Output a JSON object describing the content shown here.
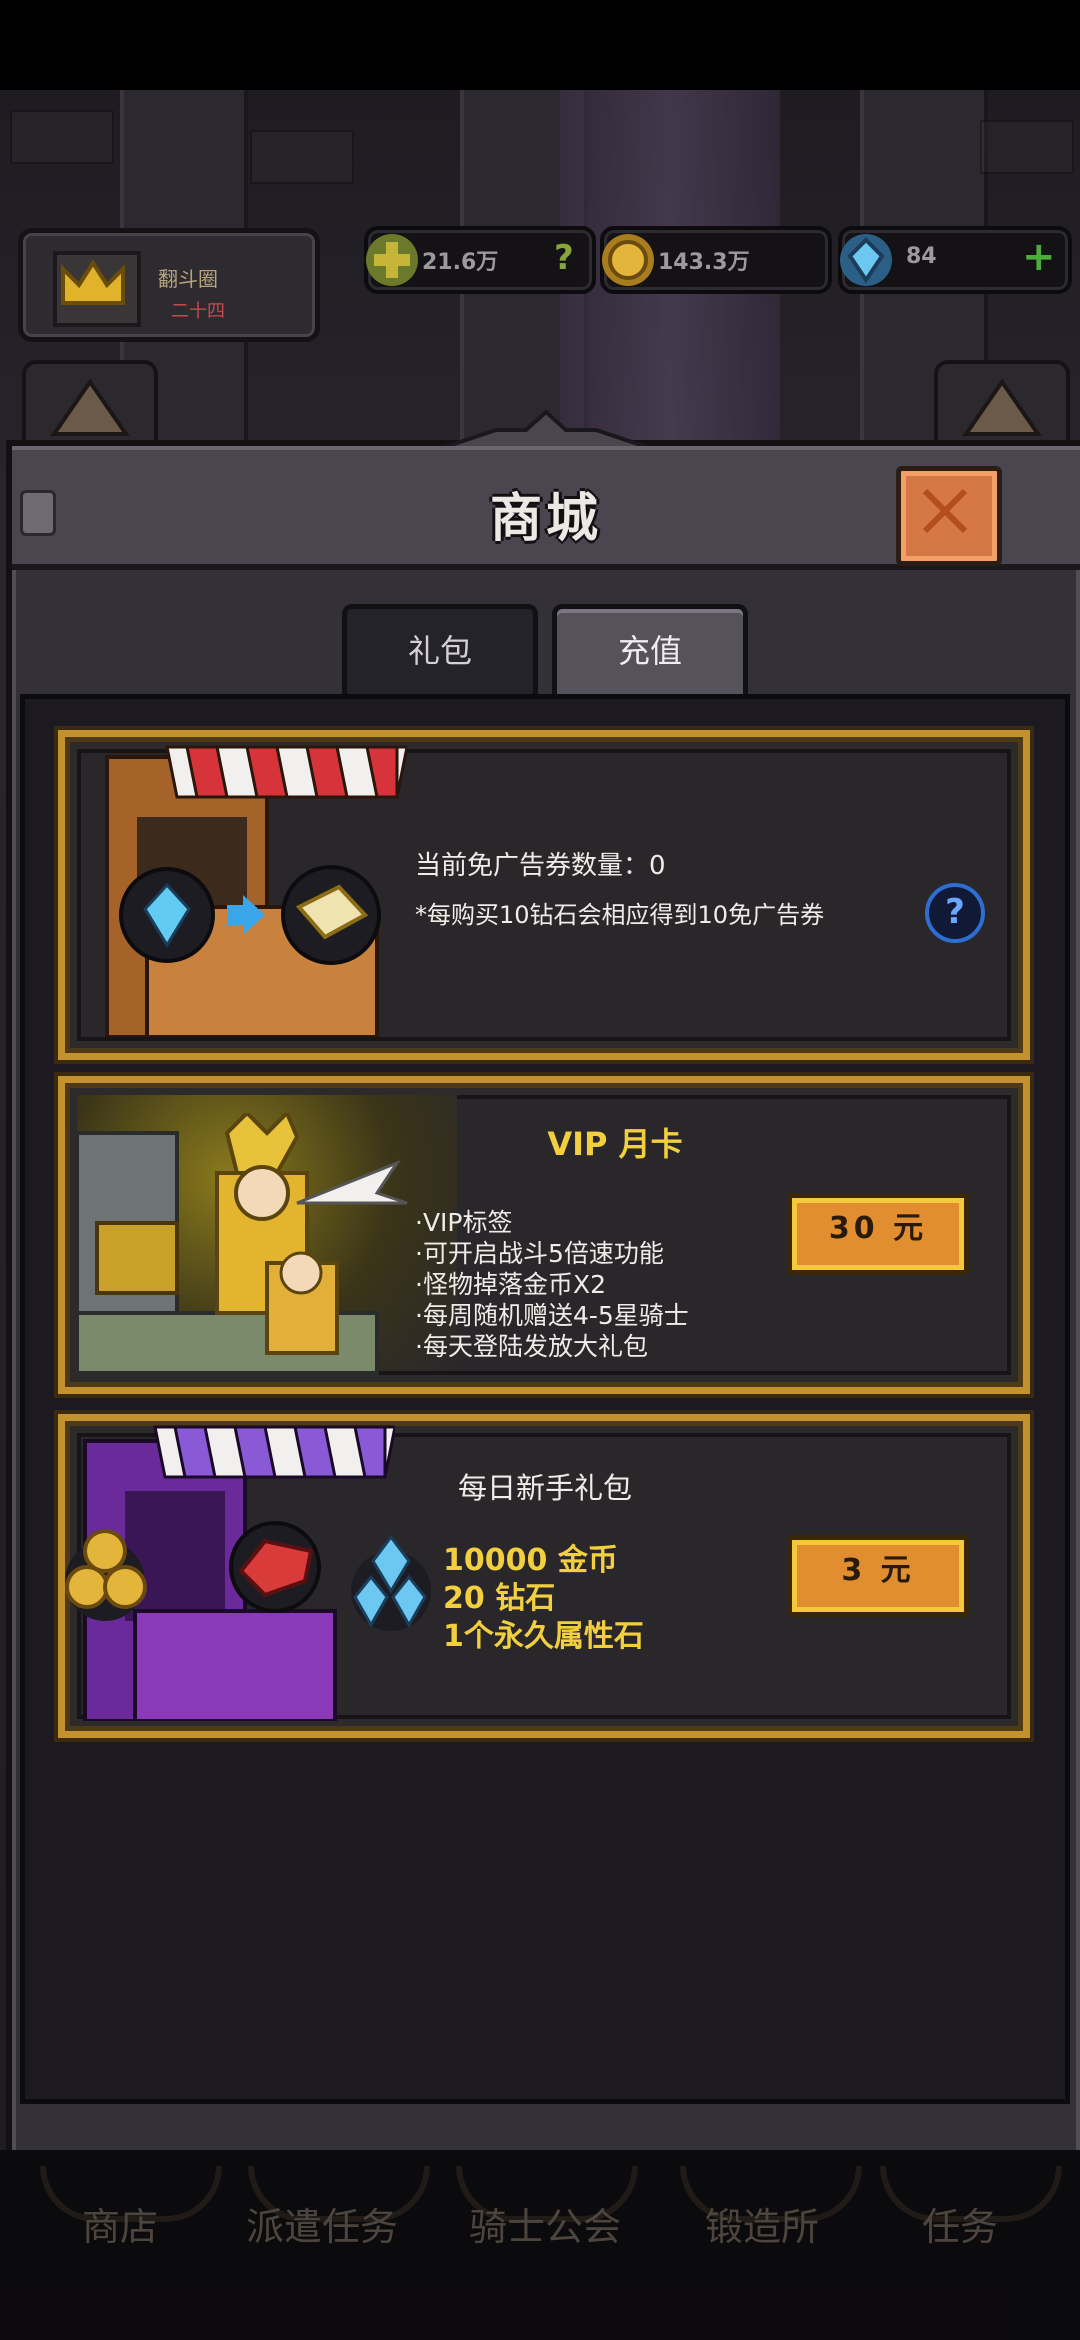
{
  "hud": {
    "rank_name": "翻斗圈",
    "rank_sub": "二十四",
    "resources": [
      {
        "icon": "plus-badge-icon",
        "value": "21.6万",
        "extra": "?"
      },
      {
        "icon": "gold-coin-icon",
        "value": "143.3万",
        "extra": ""
      },
      {
        "icon": "diamond-icon",
        "value": "84",
        "extra": "+"
      }
    ]
  },
  "modal": {
    "title": "商城",
    "tabs": [
      {
        "label": "礼包",
        "active": false
      },
      {
        "label": "充值",
        "active": true
      }
    ]
  },
  "ad_card": {
    "count_line": "当前免广告券数量：0",
    "note_line": "*每购买10钻石会相应得到10免广告券",
    "help": "?"
  },
  "vip_card": {
    "title": "VIP 月卡",
    "perks": [
      "·VIP标签",
      "·可开启战斗5倍速功能",
      "·怪物掉落金币X2",
      "·每周随机赠送4-5星骑士",
      "·每天登陆发放大礼包"
    ],
    "price_label": "30 元"
  },
  "daily_card": {
    "title": "每日新手礼包",
    "rewards": [
      "10000 金币",
      "20 钻石",
      "1个永久属性石"
    ],
    "price_label": "3 元"
  },
  "bottom_nav": [
    "商店",
    "派遣任务",
    "骑士公会",
    "锻造所",
    "任务"
  ],
  "colors": {
    "card_border": "#c3922e",
    "button_fill": "#e08e2f",
    "button_rim": "#f6c83c",
    "close_fill": "#d57845"
  }
}
